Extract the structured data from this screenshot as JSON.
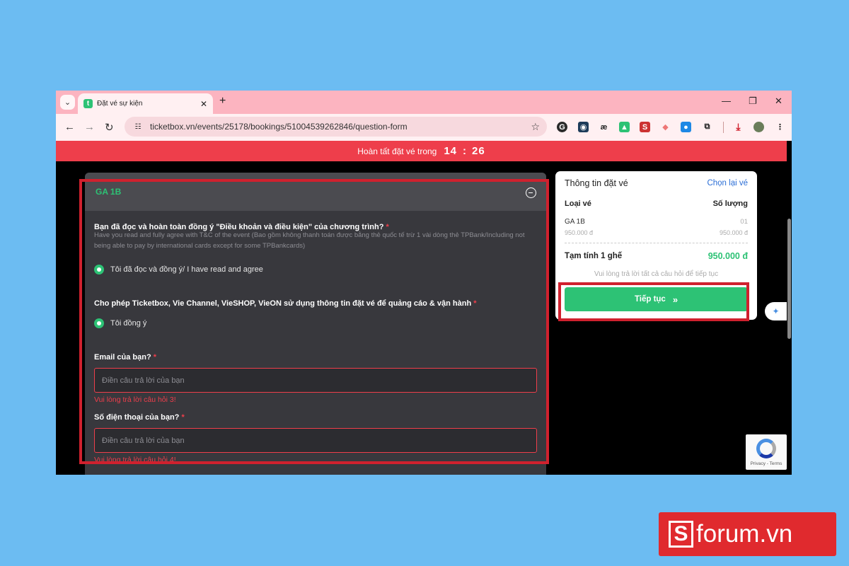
{
  "browser": {
    "tab_title": "Đặt vé sự kiện",
    "tab_favicon": "t",
    "url": "ticketbox.vn/events/25178/bookings/51004539262846/question-form"
  },
  "timer": {
    "label": "Hoàn tất đặt vé trong",
    "minutes": "14",
    "separator": ":",
    "seconds": "26"
  },
  "form": {
    "section_title": "GA 1B",
    "questions": [
      {
        "title": "Bạn đã đọc và hoàn toàn đồng ý \"Điều khoản và điều kiện\" của chương trình?",
        "subtitle": "Have you read and fully agree with T&C of the event (Bao gồm không thanh toán được bằng thẻ quốc tế trừ 1 vài dòng thẻ TPBank/Including not being able to pay by international cards except for some TPBankcards)",
        "option": "Tôi đã đọc và đồng ý/ I have read and agree"
      },
      {
        "title": "Cho phép Ticketbox, Vie Channel, VieSHOP, VieON sử dụng thông tin đặt vé để quảng cáo & vận hành",
        "option": "Tôi đồng ý"
      },
      {
        "title": "Email của bạn?",
        "placeholder": "Điền câu trả lời của bạn",
        "error": "Vui lòng trả lời câu hỏi 3!"
      },
      {
        "title": "Số điện thoại của bạn?",
        "placeholder": "Điền câu trả lời của bạn",
        "error": "Vui lòng trả lời câu hỏi 4!"
      }
    ],
    "required_mark": "*"
  },
  "summary": {
    "title": "Thông tin đặt vé",
    "reset_link": "Chọn lại vé",
    "col_type": "Loại vé",
    "col_qty": "Số lượng",
    "ticket_name": "GA 1B",
    "ticket_price": "950.000 đ",
    "ticket_qty": "01",
    "ticket_subtotal": "950.000 đ",
    "total_label": "Tạm tính 1 ghế",
    "total_value": "950.000 đ",
    "hint": "Vui lòng trả lời tất cả câu hỏi để tiếp tục",
    "continue_label": "Tiếp tục"
  },
  "recaptcha": {
    "links": "Privacy - Terms"
  },
  "brand": {
    "letter": "S",
    "text": "forum.vn"
  },
  "colors": {
    "background": "#6cbcf2",
    "timer_bar": "#ee3e4b",
    "accent_green": "#2dc275",
    "highlight": "#d0212e",
    "link_blue": "#2b6ed6"
  }
}
